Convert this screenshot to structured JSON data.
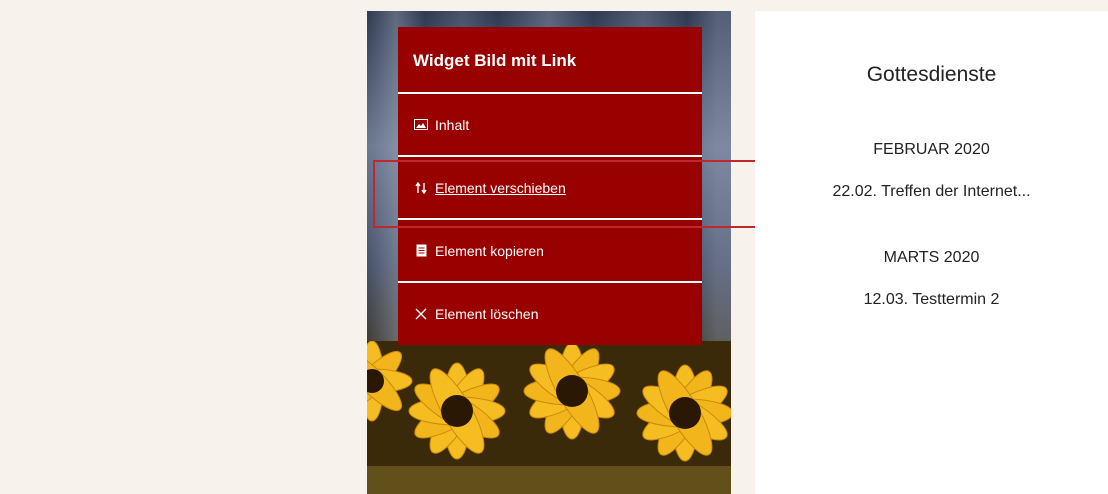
{
  "menu": {
    "title": "Widget Bild mit Link",
    "items": [
      {
        "label": "Inhalt",
        "icon": "image-icon"
      },
      {
        "label": "Element verschieben",
        "icon": "move-arrows-icon"
      },
      {
        "label": "Element kopieren",
        "icon": "copy-icon"
      },
      {
        "label": "Element löschen",
        "icon": "close-icon"
      }
    ]
  },
  "panel": {
    "title": "Gottesdienste",
    "months": [
      {
        "name": "FEBRUAR 2020",
        "events": [
          "22.02. Treffen der Internet..."
        ]
      },
      {
        "name": "MARTS 2020",
        "events": [
          "12.03. Testtermin 2"
        ]
      }
    ]
  },
  "colors": {
    "menu_bg": "#990000",
    "highlight": "#c0282d",
    "page_bg": "#f7f3ec"
  }
}
